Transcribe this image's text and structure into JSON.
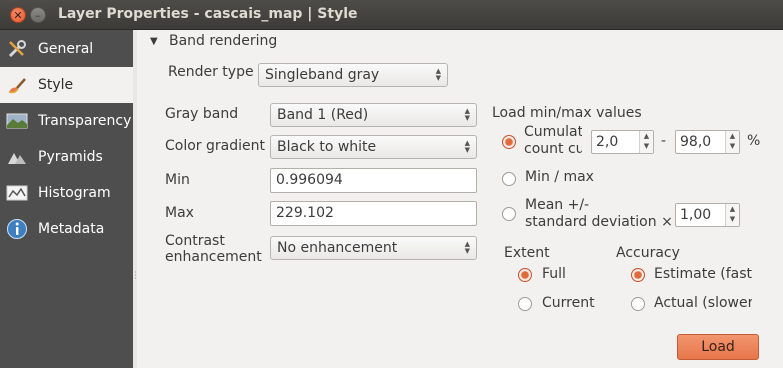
{
  "window": {
    "title": "Layer Properties - cascais_map | Style",
    "close_glyph": "✕",
    "minimize_glyph": "–"
  },
  "sidebar": {
    "items": [
      {
        "label": "General",
        "icon": "wrench-screwdriver-icon"
      },
      {
        "label": "Style",
        "icon": "paintbrush-icon",
        "selected": true
      },
      {
        "label": "Transparency",
        "icon": "transparency-icon"
      },
      {
        "label": "Pyramids",
        "icon": "pyramids-icon"
      },
      {
        "label": "Histogram",
        "icon": "histogram-icon"
      },
      {
        "label": "Metadata",
        "icon": "info-icon"
      }
    ]
  },
  "band_rendering": {
    "section_label": "Band rendering",
    "render_type_label": "Render type",
    "render_type_value": "Singleband gray",
    "gray_band_label": "Gray band",
    "gray_band_value": "Band 1 (Red)",
    "color_gradient_label": "Color gradient",
    "color_gradient_value": "Black to white",
    "min_label": "Min",
    "min_value": "0.996094",
    "max_label": "Max",
    "max_value": "229.102",
    "contrast_label_line1": "Contrast",
    "contrast_label_line2": "enhancement",
    "contrast_value": "No enhancement"
  },
  "load_minmax": {
    "title": "Load min/max values",
    "cumulative_line1": "Cumulati",
    "cumulative_line2": "count cu",
    "cumulative_low": "2,0",
    "dash": "-",
    "cumulative_high": "98,0",
    "percent": "%",
    "minmax_label": "Min / max",
    "mean_line1": "Mean +/-",
    "mean_line2": "standard deviation ×",
    "stddev_value": "1,00",
    "extent_title": "Extent",
    "extent_full": "Full",
    "extent_current": "Current",
    "accuracy_title": "Accuracy",
    "accuracy_estimate": "Estimate (faste",
    "accuracy_actual": "Actual (slower)",
    "load_button": "Load"
  },
  "colors": {
    "accent": "#e8764a",
    "sidebar_bg": "#4e4e4e",
    "titlebar_bg": "#3c3b37"
  }
}
